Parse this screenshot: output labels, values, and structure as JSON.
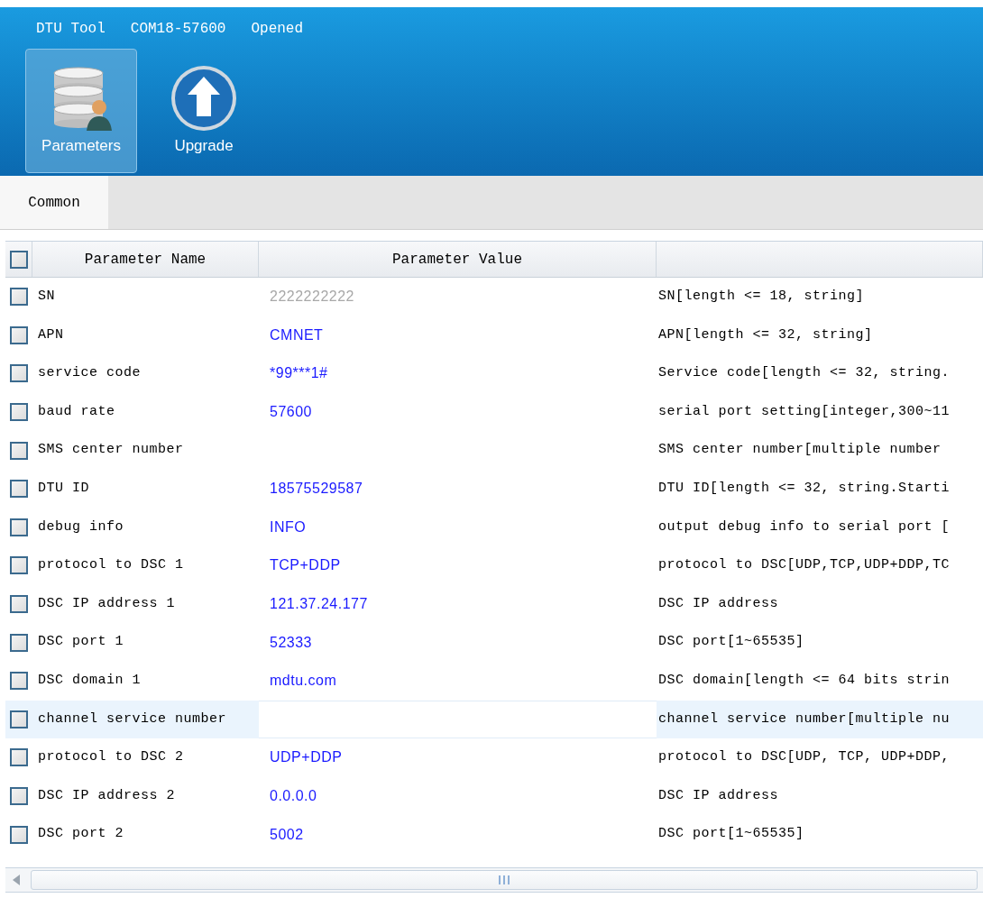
{
  "title_bar": {
    "items": [
      "DTU Tool",
      "COM18-57600",
      "Opened"
    ]
  },
  "toolbar": [
    {
      "label": "Parameters",
      "kind": "database",
      "selected": true
    },
    {
      "label": "Upgrade",
      "kind": "upload",
      "selected": false
    }
  ],
  "tabs": [
    {
      "label": "Common",
      "selected": true
    }
  ],
  "table": {
    "columns": [
      "Parameter Name",
      "Parameter Value",
      ""
    ],
    "header_checked": false,
    "rows": [
      {
        "name": "SN",
        "value": "2222222222",
        "description": "SN[length <= 18, string]",
        "checked": false,
        "selected": false,
        "disabled": true
      },
      {
        "name": "APN",
        "value": "CMNET",
        "description": "APN[length <= 32, string]",
        "checked": false,
        "selected": false,
        "disabled": false
      },
      {
        "name": "service code",
        "value": "*99***1#",
        "description": "Service code[length <= 32, string.",
        "checked": false,
        "selected": false,
        "disabled": false
      },
      {
        "name": "baud rate",
        "value": "57600",
        "description": "serial port setting[integer,300~11",
        "checked": false,
        "selected": false,
        "disabled": false
      },
      {
        "name": "SMS center number",
        "value": "",
        "description": "SMS center number[multiple number",
        "checked": false,
        "selected": false
      },
      {
        "name": "DTU ID",
        "value": "18575529587",
        "description": "DTU ID[length <= 32, string.Starti",
        "checked": false,
        "selected": false,
        "disabled": false
      },
      {
        "name": "debug info",
        "value": "INFO",
        "description": "output debug info to serial port [",
        "checked": false,
        "selected": false,
        "disabled": false
      },
      {
        "name": "protocol to DSC 1",
        "value": "TCP+DDP",
        "description": "protocol to DSC[UDP,TCP,UDP+DDP,TC",
        "checked": false,
        "selected": false,
        "disabled": false
      },
      {
        "name": "DSC IP address 1",
        "value": "121.37.24.177",
        "description": "DSC IP address",
        "checked": false,
        "selected": false,
        "disabled": false
      },
      {
        "name": "DSC port 1",
        "value": "52333",
        "description": "DSC port[1~65535]",
        "checked": false,
        "selected": false,
        "disabled": false
      },
      {
        "name": "DSC domain 1",
        "value": "mdtu.com",
        "description": "DSC domain[length <= 64 bits strin",
        "checked": false,
        "selected": false,
        "disabled": false
      },
      {
        "name": "channel service number",
        "value": "",
        "description": "channel service number[multiple nu",
        "checked": false,
        "selected": true
      },
      {
        "name": "protocol to DSC 2",
        "value": "UDP+DDP",
        "description": "protocol to DSC[UDP, TCP, UDP+DDP,",
        "checked": false,
        "selected": false,
        "disabled": false
      },
      {
        "name": "DSC IP address 2",
        "value": "0.0.0.0",
        "description": "DSC IP address",
        "checked": false,
        "selected": false,
        "disabled": false
      },
      {
        "name": "DSC port 2",
        "value": "5002",
        "description": "DSC port[1~65535]",
        "checked": false,
        "selected": false,
        "disabled": false
      }
    ]
  }
}
